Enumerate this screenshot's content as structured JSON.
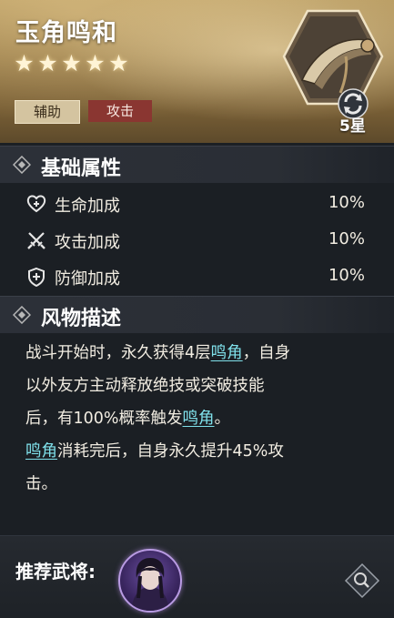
{
  "item": {
    "name": "玉角鸣和",
    "star_count": 5,
    "stars": [
      "★",
      "★",
      "★",
      "★",
      "★"
    ],
    "tags": [
      "辅助",
      "攻击"
    ],
    "rarity_label": "5星"
  },
  "attributes": {
    "title": "基础属性",
    "rows": [
      {
        "name": "生命加成",
        "value": "10%",
        "icon": "heart-plus-icon"
      },
      {
        "name": "攻击加成",
        "value": "10%",
        "icon": "crossed-swords-icon"
      },
      {
        "name": "防御加成",
        "value": "10%",
        "icon": "shield-icon"
      }
    ]
  },
  "description": {
    "title": "风物描述",
    "line1_a": "战斗开始时，永久获得4层",
    "kw1": "鸣角",
    "line1_b": "，自身",
    "line2": "以外友方主动释放绝技或突破技能",
    "line3_a": "后，有100%概率触发",
    "kw2": "鸣角",
    "line3_b": "。",
    "kw3": "鸣角",
    "line4_a": "消耗完后，自身永久提升45%攻",
    "line5": "击。"
  },
  "footer": {
    "recommend_label": "推荐武将:"
  },
  "colors": {
    "keyword": "#7fe0ea",
    "tag_attack": "#8a3631",
    "tag_support": "#d4c4a0",
    "header_gold": "#9a7d49"
  }
}
